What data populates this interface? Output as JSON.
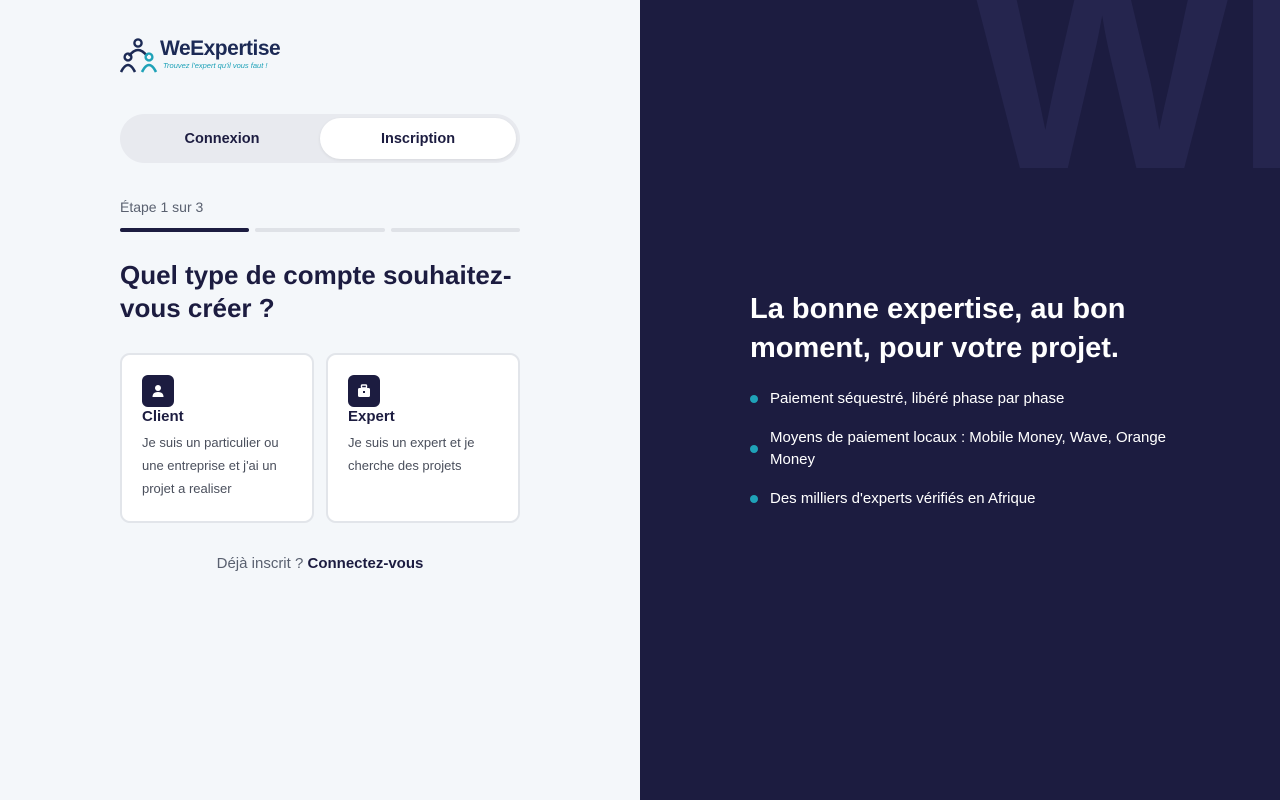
{
  "brand": {
    "name": "WeExpertise",
    "tagline": "Trouvez l'expert qu'il vous faut !"
  },
  "tabs": [
    {
      "label": "Connexion",
      "active": false
    },
    {
      "label": "Inscription",
      "active": true
    }
  ],
  "step": {
    "label": "Étape 1 sur 3",
    "current": 1,
    "total": 3
  },
  "question": "Quel type de compte souhaitez-vous créer ?",
  "account_types": [
    {
      "title": "Client",
      "description": "Je suis un particulier ou une entreprise et j'ai un projet a realiser",
      "icon": "user-icon"
    },
    {
      "title": "Expert",
      "description": "Je suis un expert et je cherche des projets",
      "icon": "briefcase-icon"
    }
  ],
  "signin": {
    "prompt": "Déjà inscrit ?",
    "link": "Connectez-vous"
  },
  "hero": {
    "watermark": "WE",
    "headline": "La bonne expertise, au bon moment, pour votre projet.",
    "bullets": [
      "Paiement séquestré, libéré phase par phase",
      "Moyens de paiement locaux : Mobile Money, Wave, Orange Money",
      "Des milliers d'experts vérifiés en Afrique"
    ]
  },
  "colors": {
    "navy": "#1c1c40",
    "accent": "#1fa2b8",
    "background": "#f4f7fa"
  }
}
